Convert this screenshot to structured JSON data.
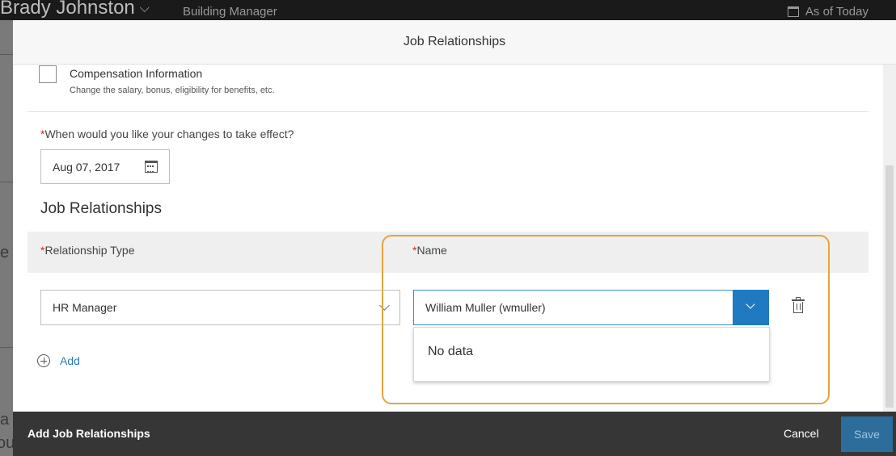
{
  "background": {
    "user_name": "Brady Johnston",
    "job_title": "Building Manager",
    "as_of": "As of Today",
    "fragments": [
      "e",
      "a",
      "ou"
    ]
  },
  "dialog": {
    "title": "Job Relationships",
    "compensation": {
      "title": "Compensation Information",
      "description": "Change the salary, bonus, eligibility for benefits, etc.",
      "checked": false
    },
    "effective": {
      "required_mark": "*",
      "question": "When would you like your changes to take effect?",
      "date": "Aug 07, 2017"
    },
    "section_title": "Job Relationships",
    "table": {
      "col_type": "Relationship Type",
      "col_name": "Name",
      "rows": [
        {
          "type": "HR Manager",
          "name": "William Muller (wmuller)"
        }
      ]
    },
    "dropdown_message": "No data",
    "add_label": "Add",
    "footer": {
      "title": "Add Job Relationships",
      "cancel": "Cancel",
      "save": "Save"
    }
  },
  "colors": {
    "accent": "#1f7ac1",
    "required": "#d0271d",
    "highlight": "#e8a33a",
    "footer_bg": "#363636"
  }
}
